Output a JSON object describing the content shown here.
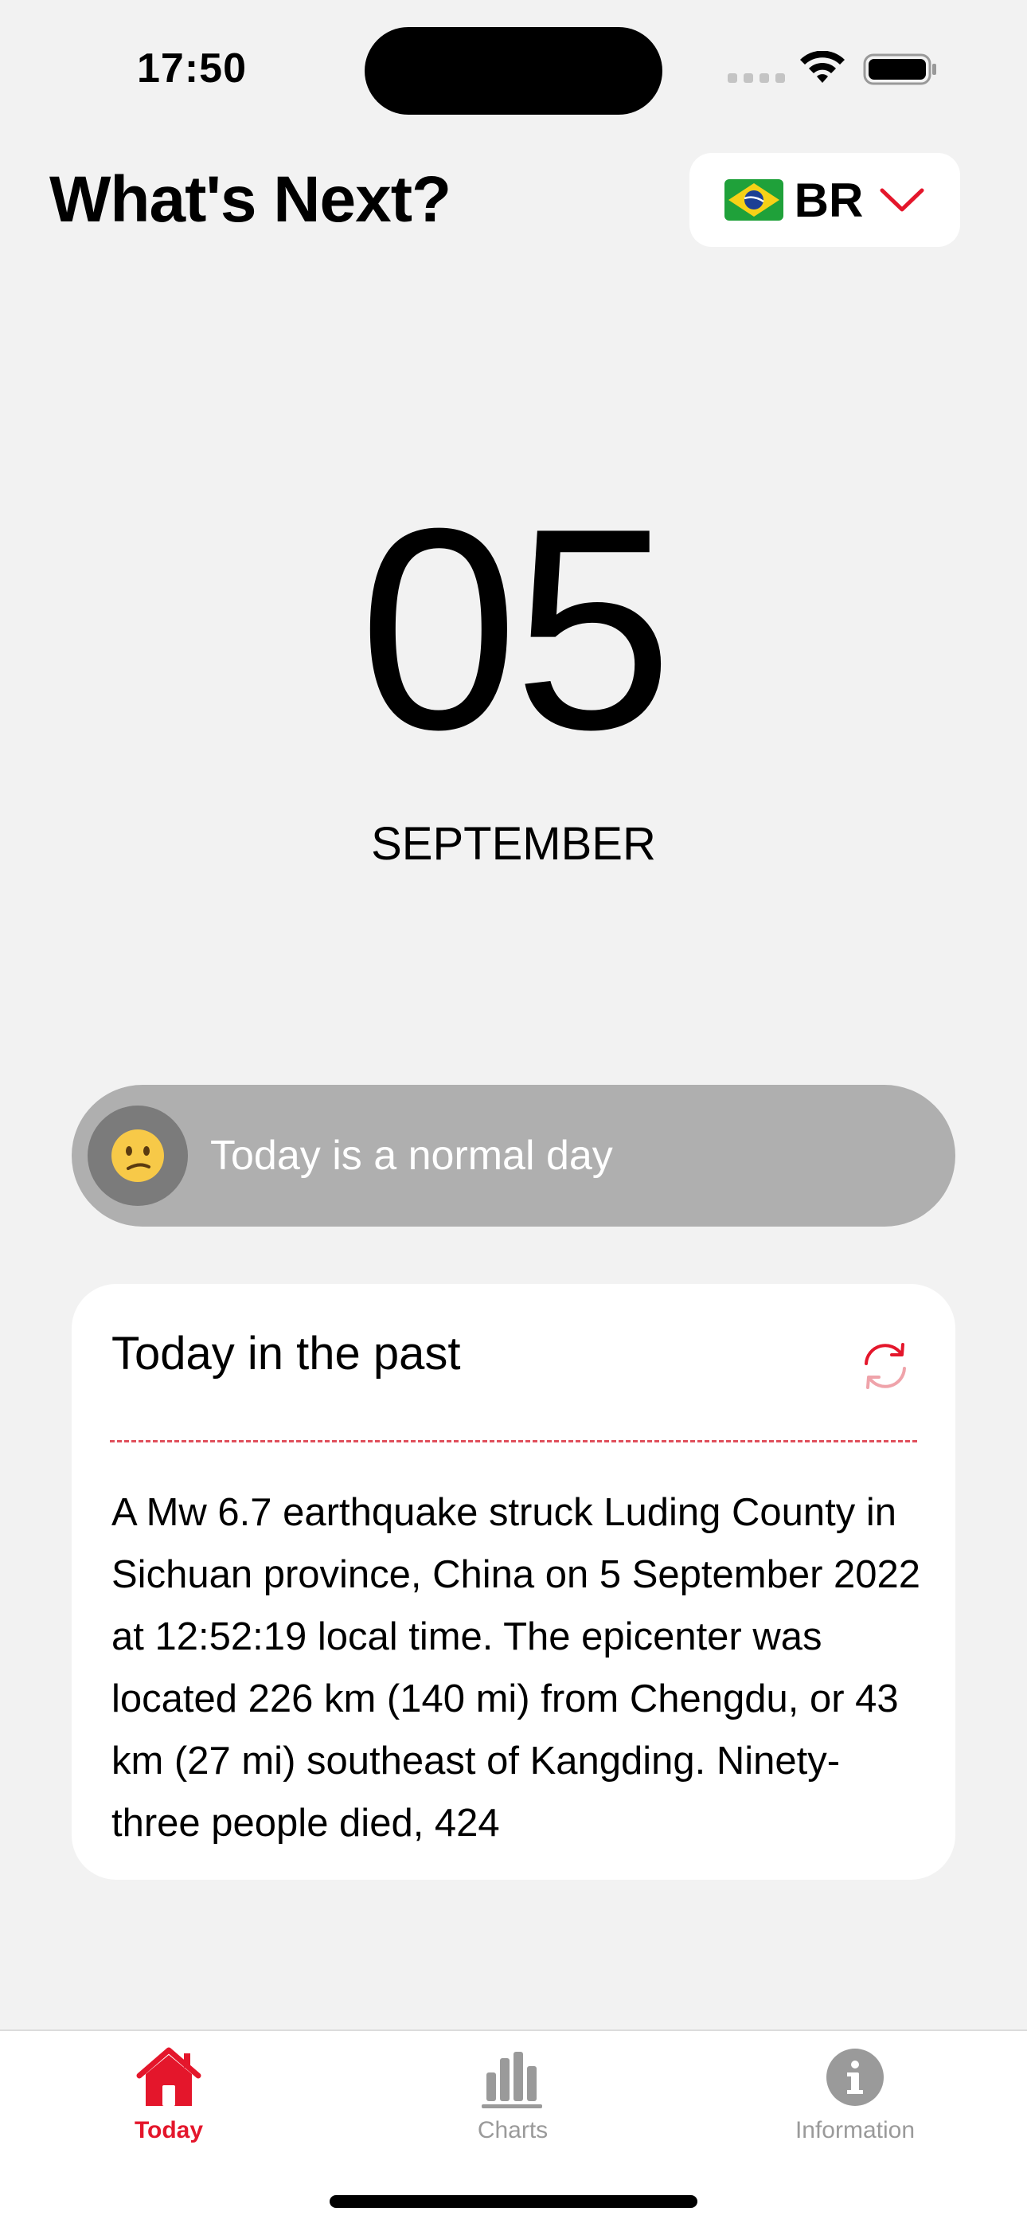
{
  "status_bar": {
    "time": "17:50"
  },
  "header": {
    "title": "What's Next?",
    "country": {
      "flag_icon": "brazil-flag-icon",
      "code": "BR",
      "chevron_icon": "chevron-down-icon"
    }
  },
  "date": {
    "day": "05",
    "month": "SEPTEMBER"
  },
  "day_status": {
    "emoji_icon": "confused-face-icon",
    "text": "Today is a normal day"
  },
  "history_card": {
    "title": "Today in the past",
    "refresh_icon": "refresh-icon",
    "body": "A Mw 6.7 earthquake struck Luding County in Sichuan province, China on 5 September 2022 at 12:52:19 local time. The epicenter was located 226 km (140 mi) from Chengdu, or 43 km (27 mi) southeast of Kangding. Ninety-three people died, 424"
  },
  "tab_bar": {
    "items": [
      {
        "label": "Today",
        "icon": "home-icon",
        "active": true
      },
      {
        "label": "Charts",
        "icon": "bar-chart-icon",
        "active": false
      },
      {
        "label": "Information",
        "icon": "info-icon",
        "active": false
      }
    ]
  },
  "colors": {
    "accent": "#e4162b",
    "background": "#f2f2f2",
    "pill_background": "#afafaf",
    "inactive_tab": "#9a9a9a"
  }
}
